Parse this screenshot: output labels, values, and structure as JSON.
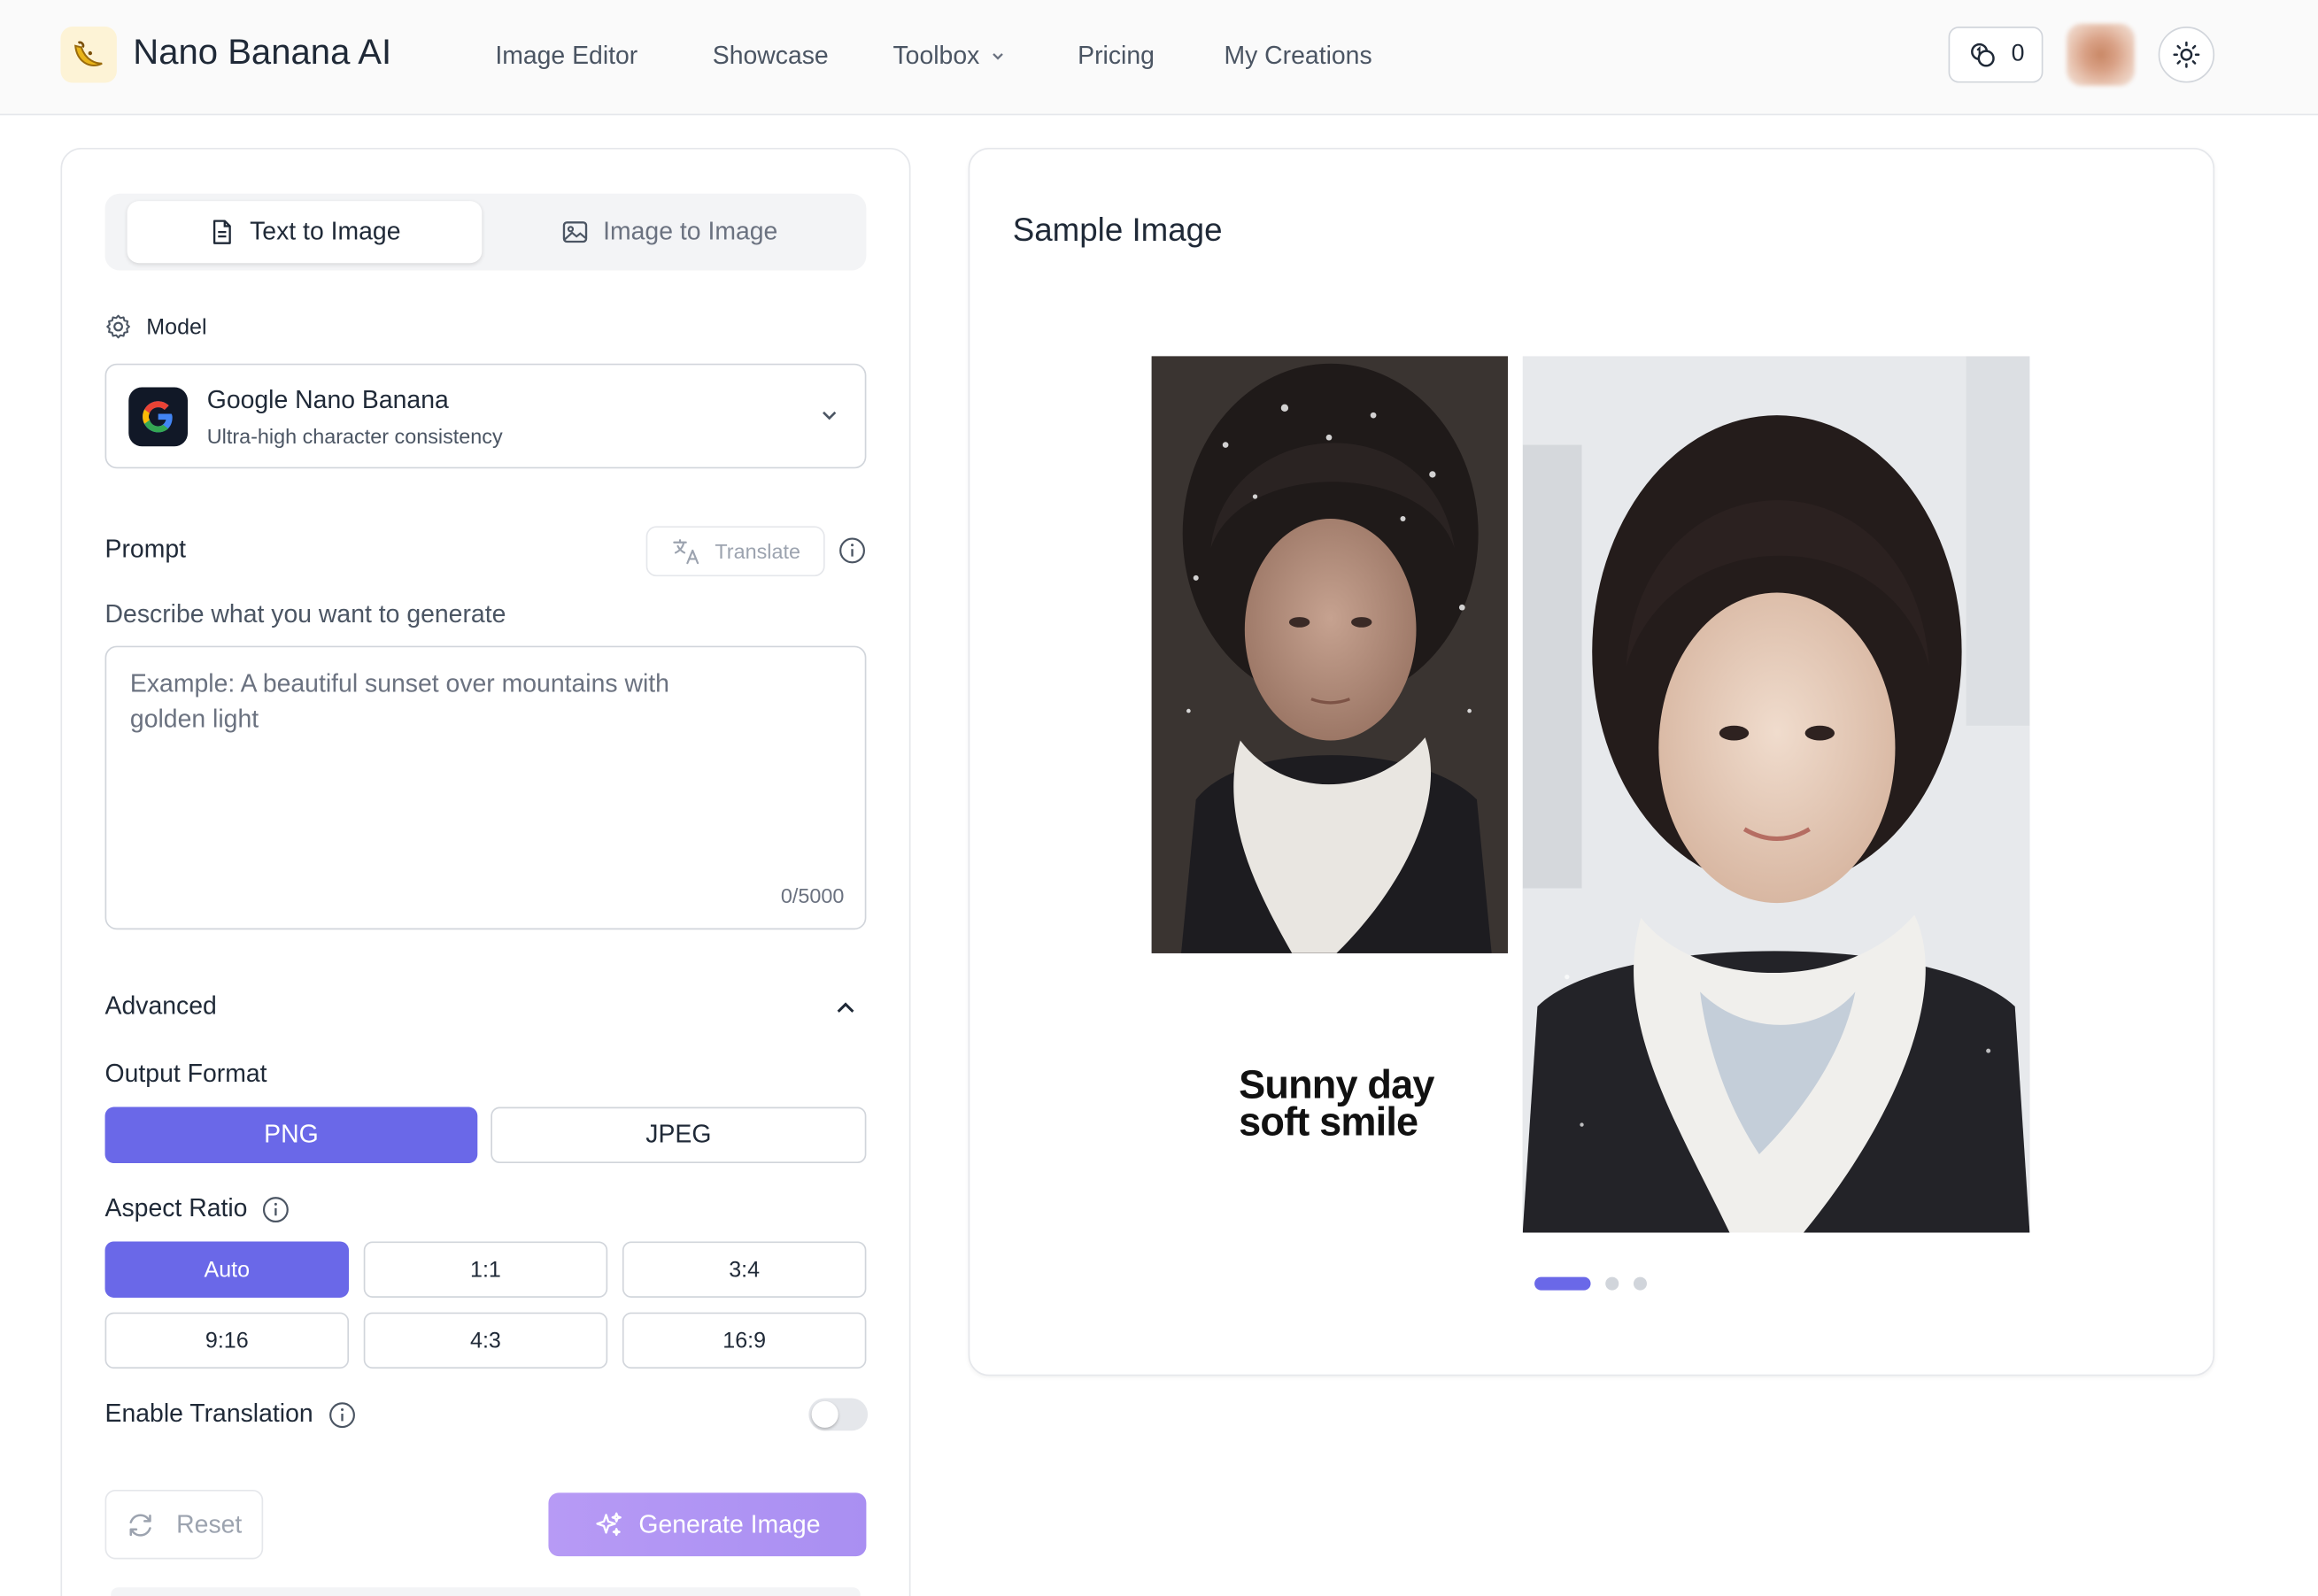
{
  "header": {
    "brand": "Nano Banana AI",
    "nav": [
      {
        "label": "Image Editor"
      },
      {
        "label": "Showcase"
      },
      {
        "label": "Toolbox"
      },
      {
        "label": "Pricing"
      },
      {
        "label": "My Creations"
      }
    ],
    "credits": "0"
  },
  "tabs": {
    "text_to_image": "Text to Image",
    "image_to_image": "Image to Image",
    "active": "Text to Image"
  },
  "model": {
    "label": "Model",
    "name": "Google Nano Banana",
    "description": "Ultra-high character consistency"
  },
  "prompt": {
    "label": "Prompt",
    "translate": "Translate",
    "hint": "Describe what you want to generate",
    "placeholder": "Example: A beautiful sunset over mountains with golden light",
    "value": "",
    "counter": "0/5000"
  },
  "advanced": {
    "label": "Advanced",
    "output_format": {
      "label": "Output Format",
      "options": [
        "PNG",
        "JPEG"
      ],
      "selected": "PNG"
    },
    "aspect_ratio": {
      "label": "Aspect Ratio",
      "options": [
        "Auto",
        "1:1",
        "3:4",
        "9:16",
        "4:3",
        "16:9"
      ],
      "selected": "Auto"
    },
    "enable_translation": {
      "label": "Enable Translation",
      "enabled": false
    }
  },
  "actions": {
    "reset": "Reset",
    "generate": "Generate Image"
  },
  "sample": {
    "title": "Sample Image",
    "caption_line1": "Sunny day",
    "caption_line2": "soft smile",
    "slides": 3,
    "active_slide": 1
  },
  "colors": {
    "accent": "#6a68e8",
    "generate_gradient_start": "#b79af5",
    "generate_gradient_end": "#a98ff2"
  },
  "icons": {
    "logo": "banana-icon",
    "credits": "coins-icon",
    "theme": "sun-icon",
    "model_label": "gear-icon",
    "model_logo": "google-logo",
    "translate": "translate-icon",
    "info": "info-icon",
    "reset": "refresh-icon",
    "generate": "sparkles-icon"
  }
}
